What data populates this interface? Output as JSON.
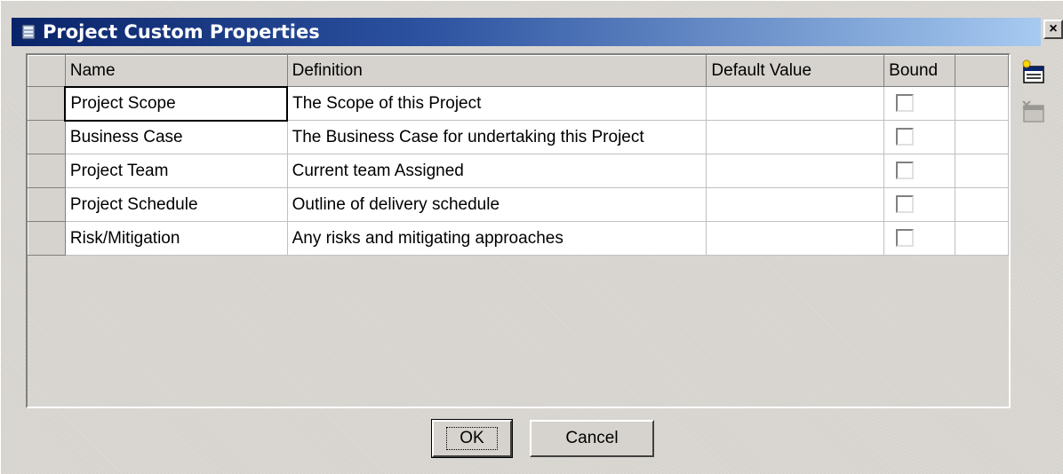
{
  "window": {
    "title": "Project Custom Properties",
    "close_label": "×"
  },
  "table": {
    "columns": [
      "Name",
      "Definition",
      "Default Value",
      "Bound",
      ""
    ],
    "rows": [
      {
        "name": "Project Scope",
        "definition": "The Scope of this Project",
        "default_value": "",
        "bound": false
      },
      {
        "name": "Business Case",
        "definition": "The Business Case for undertaking this Project",
        "default_value": "",
        "bound": false
      },
      {
        "name": "Project Team",
        "definition": "Current team Assigned",
        "default_value": "",
        "bound": false
      },
      {
        "name": "Project Schedule",
        "definition": "Outline of delivery schedule",
        "default_value": "",
        "bound": false
      },
      {
        "name": "Risk/Mitigation",
        "definition": "Any risks and mitigating approaches",
        "default_value": "",
        "bound": false
      }
    ]
  },
  "tools": {
    "add_icon": "add-property-icon",
    "delete_icon": "delete-property-icon"
  },
  "buttons": {
    "ok_label": "OK",
    "cancel_label": "Cancel"
  },
  "colors": {
    "title_start": "#0a246a",
    "title_end": "#a6caf0",
    "face": "#d6d3ce"
  }
}
